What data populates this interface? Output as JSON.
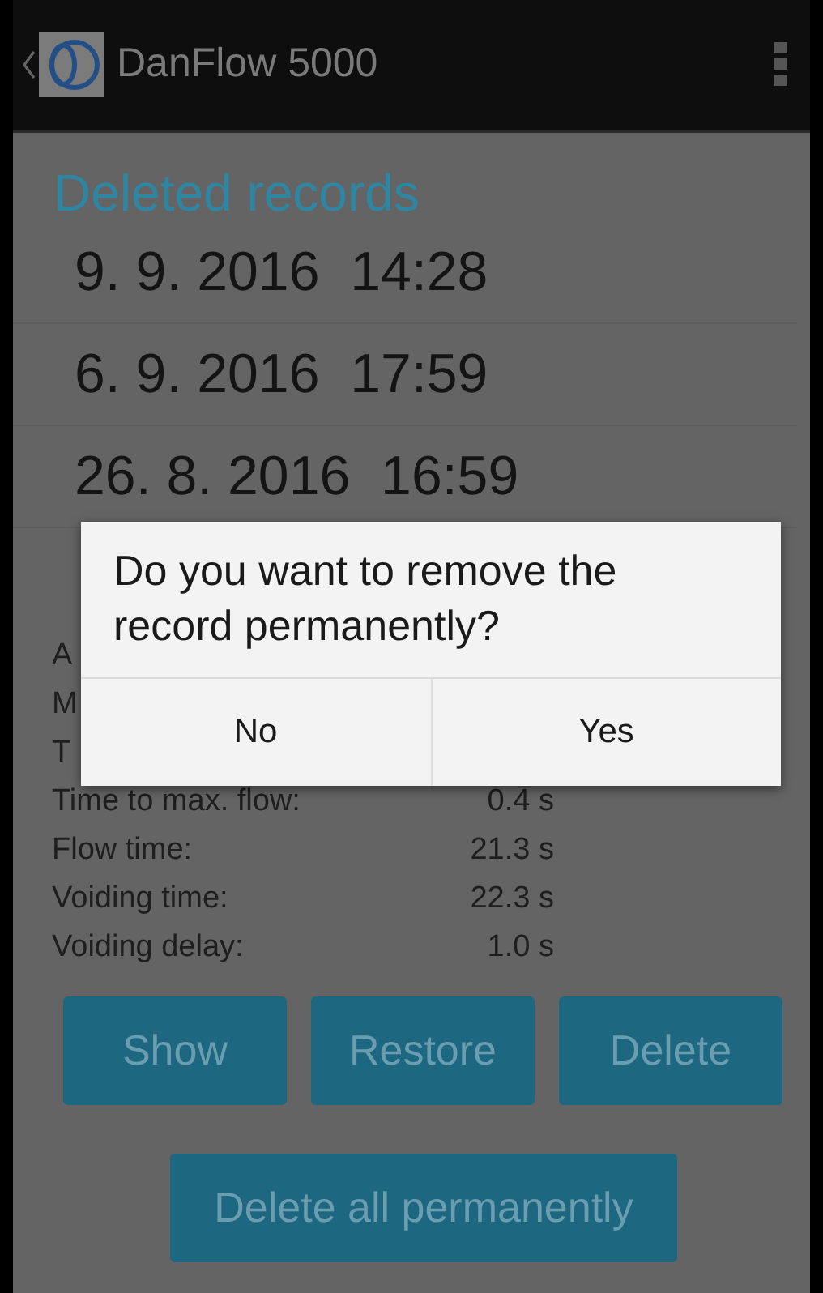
{
  "app_bar": {
    "title": "DanFlow 5000"
  },
  "section_title": "Deleted records",
  "records": [
    {
      "label": "9. 9. 2016  14:28"
    },
    {
      "label": "6. 9. 2016  17:59"
    },
    {
      "label": "26. 8. 2016  16:59"
    }
  ],
  "stats": [
    {
      "label": "A"
    },
    {
      "label": "M"
    },
    {
      "label": "T"
    },
    {
      "label": "Time to max. flow:",
      "value": "0.4 s"
    },
    {
      "label": "Flow time:",
      "value": "21.3 s"
    },
    {
      "label": "Voiding time:",
      "value": "22.3 s"
    },
    {
      "label": "Voiding delay:",
      "value": "1.0 s"
    }
  ],
  "actions": [
    "Show",
    "Restore",
    "Delete"
  ],
  "delete_all": "Delete all permanently",
  "dialog": {
    "message": "Do you want to remove the record permanently?",
    "buttons": [
      "No",
      "Yes"
    ]
  }
}
